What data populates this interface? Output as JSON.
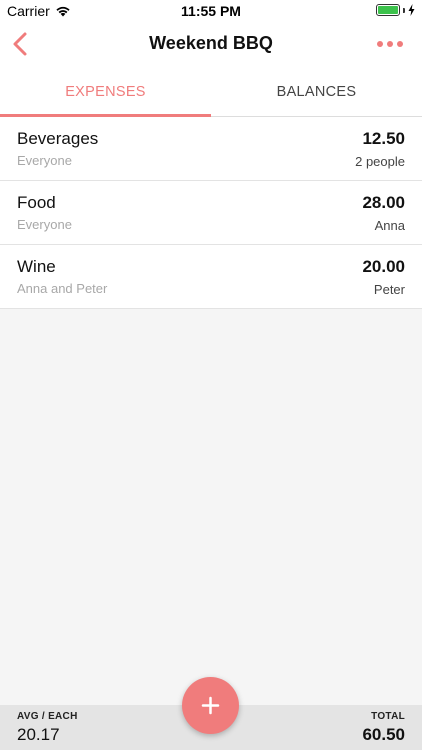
{
  "status_bar": {
    "carrier": "Carrier",
    "time": "11:55 PM"
  },
  "nav": {
    "title": "Weekend BBQ",
    "back_icon": "chevron-left-icon",
    "more_icon": "more-horizontal-icon"
  },
  "tabs": [
    {
      "label": "EXPENSES",
      "active": true
    },
    {
      "label": "BALANCES",
      "active": false
    }
  ],
  "expenses": [
    {
      "name": "Beverages",
      "split": "Everyone",
      "amount": "12.50",
      "payer": "2 people"
    },
    {
      "name": "Food",
      "split": "Everyone",
      "amount": "28.00",
      "payer": "Anna"
    },
    {
      "name": "Wine",
      "split": "Anna and Peter",
      "amount": "20.00",
      "payer": "Peter"
    }
  ],
  "footer": {
    "avg_label": "AVG / EACH",
    "avg_value": "20.17",
    "total_label": "TOTAL",
    "total_value": "60.50"
  },
  "fab": {
    "icon": "plus-icon"
  },
  "colors": {
    "accent": "#f07c7c",
    "background": "#f5f5f5",
    "footer": "#e4e4e4"
  }
}
